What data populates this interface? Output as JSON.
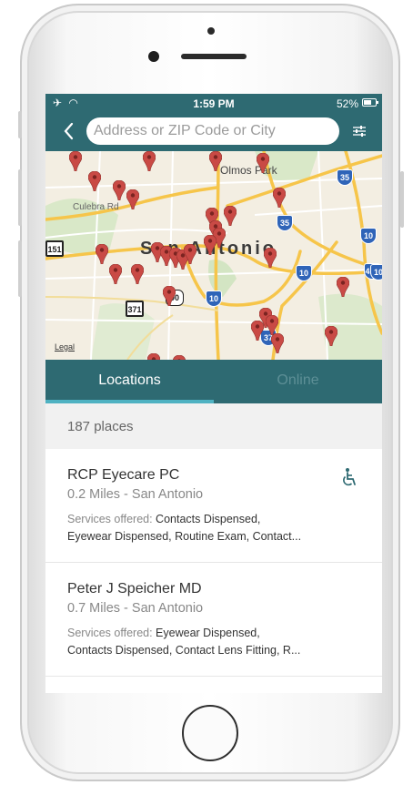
{
  "status": {
    "time": "1:59 PM",
    "battery": "52%"
  },
  "search": {
    "placeholder": "Address or ZIP Code or City"
  },
  "map": {
    "city_label": "San Antonio",
    "labels": [
      "Olmos Park",
      "Culebra Rd",
      "Legal"
    ],
    "shields": [
      "35",
      "35",
      "10",
      "10",
      "10",
      "410",
      "90",
      "10",
      "37",
      "151",
      "371"
    ]
  },
  "tabs": [
    {
      "label": "Locations",
      "active": true
    },
    {
      "label": "Online",
      "active": false
    }
  ],
  "results": {
    "count": "187 places"
  },
  "locations": [
    {
      "name": "RCP Eyecare PC",
      "distance": "0.2 Miles - San Antonio",
      "services_label": "Services offered:",
      "services_line1": " Contacts Dispensed,",
      "services_line2": "Eyewear Dispensed, Routine Exam, Contact...",
      "accessible": true
    },
    {
      "name": "Peter J Speicher MD",
      "distance": "0.7 Miles - San Antonio",
      "services_label": "Services offered:",
      "services_line1": " Eyewear Dispensed,",
      "services_line2": "Contacts Dispensed, Contact Lens Fitting, R...",
      "accessible": false
    }
  ],
  "colors": {
    "header": "#2e6a72",
    "tab_indicator": "#4fb2c2",
    "pin": "#c94a45"
  }
}
